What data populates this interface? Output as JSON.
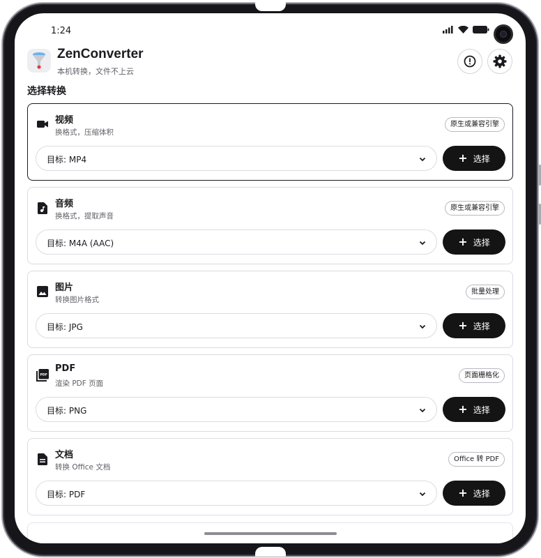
{
  "status": {
    "time": "1:24"
  },
  "header": {
    "title": "ZenConverter",
    "subtitle": "本机转换，文件不上云",
    "info_icon": "info-icon",
    "settings_icon": "gear-icon"
  },
  "section_title": "选择转换",
  "cards": [
    {
      "icon": "video-camera-icon",
      "title": "视频",
      "desc": "换格式，压缩体积",
      "badge": "原生或兼容引擎",
      "target": "目标: MP4",
      "button": "选择",
      "selected": true
    },
    {
      "icon": "audio-file-icon",
      "title": "音频",
      "desc": "换格式，提取声音",
      "badge": "原生或兼容引擎",
      "target": "目标: M4A (AAC)",
      "button": "选择",
      "selected": false
    },
    {
      "icon": "image-icon",
      "title": "图片",
      "desc": "转换图片格式",
      "badge": "批量处理",
      "target": "目标: JPG",
      "button": "选择",
      "selected": false
    },
    {
      "icon": "pdf-icon",
      "title": "PDF",
      "desc": "渲染 PDF 页面",
      "badge": "页面栅格化",
      "target": "目标: PNG",
      "button": "选择",
      "selected": false
    },
    {
      "icon": "document-icon",
      "title": "文档",
      "desc": "转换 Office 文档",
      "badge": "Office 转 PDF",
      "target": "目标: PDF",
      "button": "选择",
      "selected": false
    }
  ],
  "colors": {
    "accent": "#141414",
    "border": "#dcdce2",
    "frame": "#16161a"
  }
}
